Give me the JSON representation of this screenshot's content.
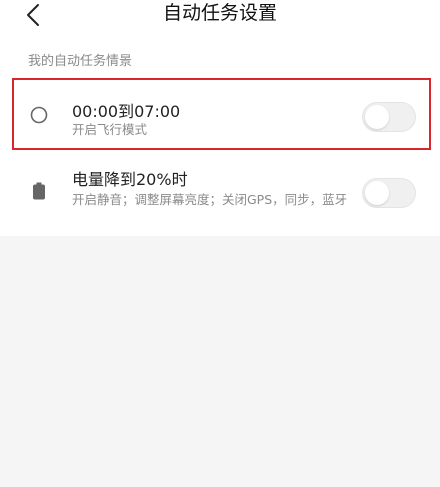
{
  "header": {
    "title": "自动任务设置",
    "back_icon": "chevron-left-icon"
  },
  "section": {
    "label": "我的自动任务情景"
  },
  "tasks": [
    {
      "icon": "moon-clock-icon",
      "title": "00:00到07:00",
      "subtitle": "开启飞行模式",
      "enabled": false,
      "highlighted": true
    },
    {
      "icon": "battery-icon",
      "title": "电量降到20%时",
      "subtitle": "开启静音；调整屏幕亮度；关闭GPS，同步，蓝牙",
      "enabled": false,
      "highlighted": false
    }
  ],
  "colors": {
    "highlight_border": "#d8262c",
    "toggle_off_track": "#f0f0f0",
    "subtitle_text": "#8a8a8a",
    "background": "#f5f5f5"
  }
}
